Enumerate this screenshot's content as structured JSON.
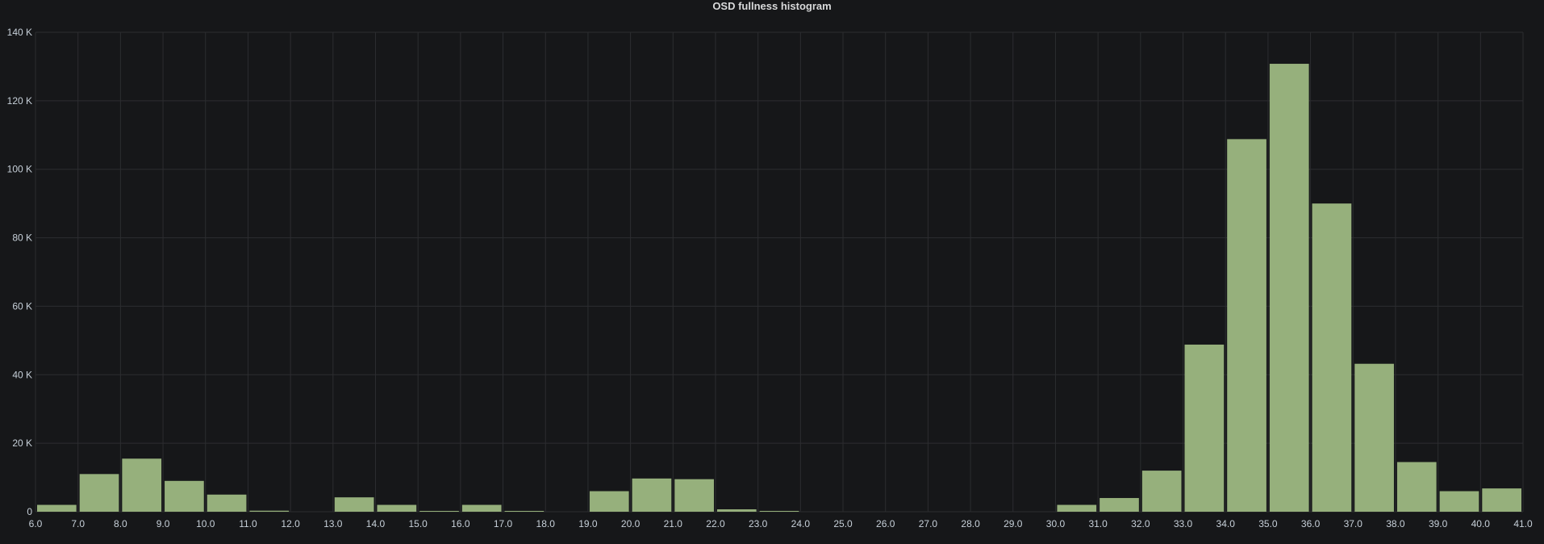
{
  "panel": {
    "title": "OSD fullness histogram"
  },
  "colors": {
    "background": "#161719",
    "grid": "#2c2d30",
    "bar": "#96b07c",
    "text": "#c7d0d9"
  },
  "chart_data": {
    "type": "bar",
    "title": "OSD fullness histogram",
    "xlabel": "",
    "ylabel": "",
    "x_ticks": [
      "6.0",
      "7.0",
      "8.0",
      "9.0",
      "10.0",
      "11.0",
      "12.0",
      "13.0",
      "14.0",
      "15.0",
      "16.0",
      "17.0",
      "18.0",
      "19.0",
      "20.0",
      "21.0",
      "22.0",
      "23.0",
      "24.0",
      "25.0",
      "26.0",
      "27.0",
      "28.0",
      "29.0",
      "30.0",
      "31.0",
      "32.0",
      "33.0",
      "34.0",
      "35.0",
      "36.0",
      "37.0",
      "38.0",
      "39.0",
      "40.0",
      "41.0"
    ],
    "y_ticks": [
      "0",
      "20 K",
      "40 K",
      "60 K",
      "80 K",
      "100 K",
      "120 K",
      "140 K"
    ],
    "xlim": [
      6,
      41
    ],
    "ylim": [
      0,
      140000
    ],
    "y_tick_step": 20000,
    "grid": true,
    "bins": [
      {
        "x": 6,
        "value": 2000
      },
      {
        "x": 7,
        "value": 11000
      },
      {
        "x": 8,
        "value": 15500
      },
      {
        "x": 9,
        "value": 9000
      },
      {
        "x": 10,
        "value": 5000
      },
      {
        "x": 11,
        "value": 300
      },
      {
        "x": 12,
        "value": 0
      },
      {
        "x": 13,
        "value": 4200
      },
      {
        "x": 14,
        "value": 2000
      },
      {
        "x": 15,
        "value": 200
      },
      {
        "x": 16,
        "value": 2000
      },
      {
        "x": 17,
        "value": 100
      },
      {
        "x": 18,
        "value": 0
      },
      {
        "x": 19,
        "value": 6000
      },
      {
        "x": 20,
        "value": 9700
      },
      {
        "x": 21,
        "value": 9500
      },
      {
        "x": 22,
        "value": 700
      },
      {
        "x": 23,
        "value": 100
      },
      {
        "x": 24,
        "value": 0
      },
      {
        "x": 25,
        "value": 0
      },
      {
        "x": 26,
        "value": 0
      },
      {
        "x": 27,
        "value": 0
      },
      {
        "x": 28,
        "value": 0
      },
      {
        "x": 29,
        "value": 0
      },
      {
        "x": 30,
        "value": 2000
      },
      {
        "x": 31,
        "value": 4000
      },
      {
        "x": 32,
        "value": 12000
      },
      {
        "x": 33,
        "value": 48800
      },
      {
        "x": 34,
        "value": 108800
      },
      {
        "x": 35,
        "value": 130800
      },
      {
        "x": 36,
        "value": 90000
      },
      {
        "x": 37,
        "value": 43200
      },
      {
        "x": 38,
        "value": 14500
      },
      {
        "x": 39,
        "value": 6000
      },
      {
        "x": 40,
        "value": 6800
      }
    ]
  }
}
